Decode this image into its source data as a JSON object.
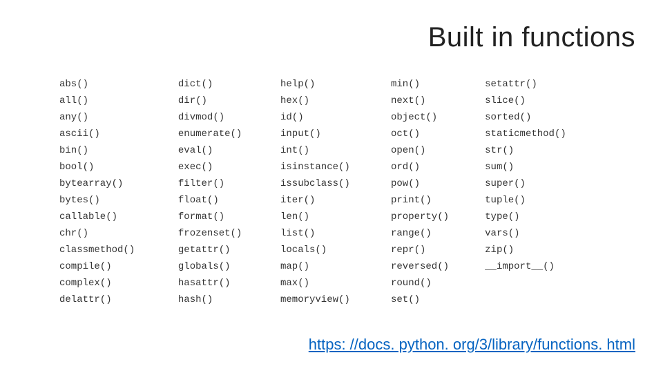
{
  "title": "Built in functions",
  "link": "https: //docs. python. org/3/library/functions. html",
  "columns": 5,
  "rows": 14,
  "functions": [
    [
      "abs()",
      "dict()",
      "help()",
      "min()",
      "setattr()"
    ],
    [
      "all()",
      "dir()",
      "hex()",
      "next()",
      "slice()"
    ],
    [
      "any()",
      "divmod()",
      "id()",
      "object()",
      "sorted()"
    ],
    [
      "ascii()",
      "enumerate()",
      "input()",
      "oct()",
      "staticmethod()"
    ],
    [
      "bin()",
      "eval()",
      "int()",
      "open()",
      "str()"
    ],
    [
      "bool()",
      "exec()",
      "isinstance()",
      "ord()",
      "sum()"
    ],
    [
      "bytearray()",
      "filter()",
      "issubclass()",
      "pow()",
      "super()"
    ],
    [
      "bytes()",
      "float()",
      "iter()",
      "print()",
      "tuple()"
    ],
    [
      "callable()",
      "format()",
      "len()",
      "property()",
      "type()"
    ],
    [
      "chr()",
      "frozenset()",
      "list()",
      "range()",
      "vars()"
    ],
    [
      "classmethod()",
      "getattr()",
      "locals()",
      "repr()",
      "zip()"
    ],
    [
      "compile()",
      "globals()",
      "map()",
      "reversed()",
      "__import__()"
    ],
    [
      "complex()",
      "hasattr()",
      "max()",
      "round()",
      ""
    ],
    [
      "delattr()",
      "hash()",
      "memoryview()",
      "set()",
      ""
    ]
  ]
}
